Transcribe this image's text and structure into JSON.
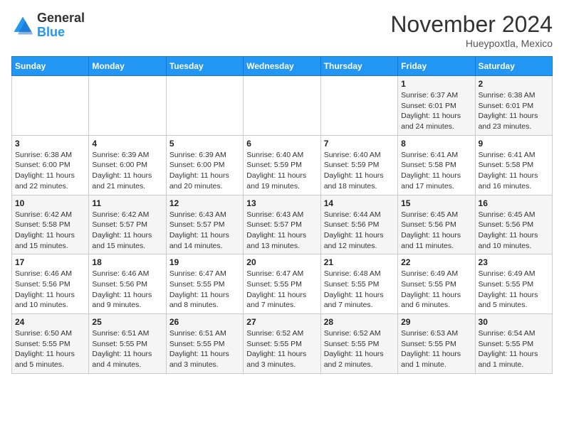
{
  "header": {
    "logo_general": "General",
    "logo_blue": "Blue",
    "month_title": "November 2024",
    "location": "Hueypoxtla, Mexico"
  },
  "days_of_week": [
    "Sunday",
    "Monday",
    "Tuesday",
    "Wednesday",
    "Thursday",
    "Friday",
    "Saturday"
  ],
  "weeks": [
    [
      {
        "day": "",
        "info": ""
      },
      {
        "day": "",
        "info": ""
      },
      {
        "day": "",
        "info": ""
      },
      {
        "day": "",
        "info": ""
      },
      {
        "day": "",
        "info": ""
      },
      {
        "day": "1",
        "info": "Sunrise: 6:37 AM\nSunset: 6:01 PM\nDaylight: 11 hours and 24 minutes."
      },
      {
        "day": "2",
        "info": "Sunrise: 6:38 AM\nSunset: 6:01 PM\nDaylight: 11 hours and 23 minutes."
      }
    ],
    [
      {
        "day": "3",
        "info": "Sunrise: 6:38 AM\nSunset: 6:00 PM\nDaylight: 11 hours and 22 minutes."
      },
      {
        "day": "4",
        "info": "Sunrise: 6:39 AM\nSunset: 6:00 PM\nDaylight: 11 hours and 21 minutes."
      },
      {
        "day": "5",
        "info": "Sunrise: 6:39 AM\nSunset: 6:00 PM\nDaylight: 11 hours and 20 minutes."
      },
      {
        "day": "6",
        "info": "Sunrise: 6:40 AM\nSunset: 5:59 PM\nDaylight: 11 hours and 19 minutes."
      },
      {
        "day": "7",
        "info": "Sunrise: 6:40 AM\nSunset: 5:59 PM\nDaylight: 11 hours and 18 minutes."
      },
      {
        "day": "8",
        "info": "Sunrise: 6:41 AM\nSunset: 5:58 PM\nDaylight: 11 hours and 17 minutes."
      },
      {
        "day": "9",
        "info": "Sunrise: 6:41 AM\nSunset: 5:58 PM\nDaylight: 11 hours and 16 minutes."
      }
    ],
    [
      {
        "day": "10",
        "info": "Sunrise: 6:42 AM\nSunset: 5:58 PM\nDaylight: 11 hours and 15 minutes."
      },
      {
        "day": "11",
        "info": "Sunrise: 6:42 AM\nSunset: 5:57 PM\nDaylight: 11 hours and 15 minutes."
      },
      {
        "day": "12",
        "info": "Sunrise: 6:43 AM\nSunset: 5:57 PM\nDaylight: 11 hours and 14 minutes."
      },
      {
        "day": "13",
        "info": "Sunrise: 6:43 AM\nSunset: 5:57 PM\nDaylight: 11 hours and 13 minutes."
      },
      {
        "day": "14",
        "info": "Sunrise: 6:44 AM\nSunset: 5:56 PM\nDaylight: 11 hours and 12 minutes."
      },
      {
        "day": "15",
        "info": "Sunrise: 6:45 AM\nSunset: 5:56 PM\nDaylight: 11 hours and 11 minutes."
      },
      {
        "day": "16",
        "info": "Sunrise: 6:45 AM\nSunset: 5:56 PM\nDaylight: 11 hours and 10 minutes."
      }
    ],
    [
      {
        "day": "17",
        "info": "Sunrise: 6:46 AM\nSunset: 5:56 PM\nDaylight: 11 hours and 10 minutes."
      },
      {
        "day": "18",
        "info": "Sunrise: 6:46 AM\nSunset: 5:56 PM\nDaylight: 11 hours and 9 minutes."
      },
      {
        "day": "19",
        "info": "Sunrise: 6:47 AM\nSunset: 5:55 PM\nDaylight: 11 hours and 8 minutes."
      },
      {
        "day": "20",
        "info": "Sunrise: 6:47 AM\nSunset: 5:55 PM\nDaylight: 11 hours and 7 minutes."
      },
      {
        "day": "21",
        "info": "Sunrise: 6:48 AM\nSunset: 5:55 PM\nDaylight: 11 hours and 7 minutes."
      },
      {
        "day": "22",
        "info": "Sunrise: 6:49 AM\nSunset: 5:55 PM\nDaylight: 11 hours and 6 minutes."
      },
      {
        "day": "23",
        "info": "Sunrise: 6:49 AM\nSunset: 5:55 PM\nDaylight: 11 hours and 5 minutes."
      }
    ],
    [
      {
        "day": "24",
        "info": "Sunrise: 6:50 AM\nSunset: 5:55 PM\nDaylight: 11 hours and 5 minutes."
      },
      {
        "day": "25",
        "info": "Sunrise: 6:51 AM\nSunset: 5:55 PM\nDaylight: 11 hours and 4 minutes."
      },
      {
        "day": "26",
        "info": "Sunrise: 6:51 AM\nSunset: 5:55 PM\nDaylight: 11 hours and 3 minutes."
      },
      {
        "day": "27",
        "info": "Sunrise: 6:52 AM\nSunset: 5:55 PM\nDaylight: 11 hours and 3 minutes."
      },
      {
        "day": "28",
        "info": "Sunrise: 6:52 AM\nSunset: 5:55 PM\nDaylight: 11 hours and 2 minutes."
      },
      {
        "day": "29",
        "info": "Sunrise: 6:53 AM\nSunset: 5:55 PM\nDaylight: 11 hours and 1 minute."
      },
      {
        "day": "30",
        "info": "Sunrise: 6:54 AM\nSunset: 5:55 PM\nDaylight: 11 hours and 1 minute."
      }
    ]
  ]
}
